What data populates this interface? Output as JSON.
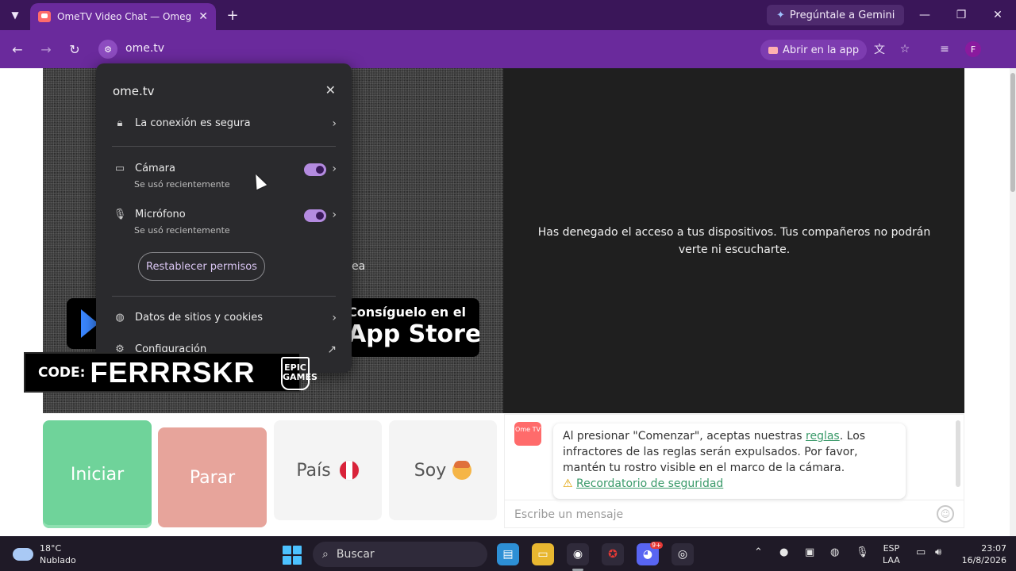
{
  "browser": {
    "tab_list_icon": "chevron-down-icon",
    "tab_title": "OmeTV Video Chat — Omegle",
    "tab_close": "✕",
    "new_tab": "+",
    "gemini_label": "Pregúntale a Gemini",
    "window_controls": [
      "—",
      "❐",
      "✕"
    ],
    "url": "ome.tv",
    "open_app_label": "Abrir en la app",
    "profile_initial": "F"
  },
  "site_popup": {
    "title": "ome.tv",
    "connection_label": "La conexión es segura",
    "camera": {
      "label": "Cámara",
      "sub": "Se usó recientemente",
      "enabled": true
    },
    "microphone": {
      "label": "Micrófono",
      "sub": "Se usó recientemente",
      "enabled": true
    },
    "reset_label": "Restablecer permisos",
    "cookies_label": "Datos de sitios y cookies",
    "settings_label": "Configuración"
  },
  "page": {
    "denied_message": "Has denegado el acceso a tus dispositivos. Tus compañeros no podrán verte ni escucharte.",
    "partial_text": "ea",
    "appstore_small": "Consíguelo en el",
    "appstore_big": "App Store",
    "buttons": {
      "start": "Iniciar",
      "stop": "Parar",
      "country": "País",
      "gender": "Soy"
    },
    "chat": {
      "logo_text": "Ome TV",
      "notice_before": "Al presionar \"Comenzar\", aceptas nuestras ",
      "rules_link": "reglas",
      "notice_after": ". Los infractores de las reglas serán expulsados. Por favor, mantén tu rostro visible en el marco de la cámara.",
      "safety_link": "Recordatorio de seguridad",
      "input_placeholder": "Escribe un mensaje"
    }
  },
  "overlay": {
    "code_label": "CODE:",
    "code_value": "FERRRSKR",
    "epic_logo_text": "EPIC GAMES"
  },
  "taskbar": {
    "temperature": "18°C",
    "weather": "Nublado",
    "search_label": "Buscar",
    "discord_badge": "9+",
    "lang_top": "ESP",
    "lang_bottom": "LAA",
    "time": "23:07",
    "date": "16/8/2026"
  },
  "colors": {
    "browser_frame": "#3a1659",
    "toolbar": "#6a2a9c",
    "start_button": "#6fd39a",
    "stop_button": "#e7a49b",
    "link_green": "#3a9a6a",
    "toggle_on": "#b48be0"
  }
}
